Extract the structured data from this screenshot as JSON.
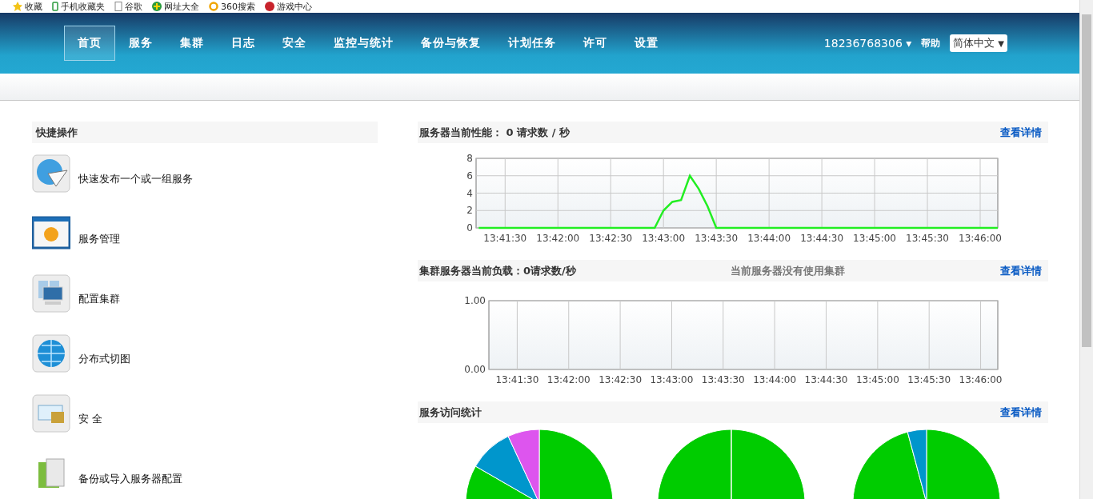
{
  "bookmarks": [
    {
      "label": "收藏",
      "kind": "star"
    },
    {
      "label": "手机收藏夹",
      "kind": "phone"
    },
    {
      "label": "谷歌",
      "kind": "page"
    },
    {
      "label": "网址大全",
      "kind": "plus"
    },
    {
      "label": "360搜索",
      "kind": "ring"
    },
    {
      "label": "游戏中心",
      "kind": "game"
    }
  ],
  "nav": [
    {
      "label": "首页",
      "selected": true
    },
    {
      "label": "服务",
      "selected": false
    },
    {
      "label": "集群",
      "selected": false
    },
    {
      "label": "日志",
      "selected": false
    },
    {
      "label": "安全",
      "selected": false
    },
    {
      "label": "监控与统计",
      "selected": false
    },
    {
      "label": "备份与恢复",
      "selected": false
    },
    {
      "label": "计划任务",
      "selected": false
    },
    {
      "label": "许可",
      "selected": false
    },
    {
      "label": "设置",
      "selected": false
    }
  ],
  "user": "18236768306",
  "user_caret": "▾",
  "help": "帮助",
  "language": "简体中文",
  "language_caret": "▼",
  "quick_actions": {
    "title": "快捷操作",
    "items": [
      {
        "label": "快速发布一个或一组服务",
        "kind": "publish"
      },
      {
        "label": "服务管理",
        "kind": "manage"
      },
      {
        "label": "配置集群",
        "kind": "cluster"
      },
      {
        "label": "分布式切图",
        "kind": "tiles"
      },
      {
        "label": "安 全",
        "kind": "security"
      },
      {
        "label": "备份或导入服务器配置",
        "kind": "backup"
      }
    ]
  },
  "performance": {
    "title": "服务器当前性能：",
    "reading": "0 请求数 / 秒",
    "link": "查看详情",
    "chart_data": {
      "type": "line",
      "grid": true,
      "ylim": [
        0,
        8
      ],
      "yticks": [
        0,
        2,
        4,
        6,
        8
      ],
      "categories": [
        null,
        null,
        null,
        "13:41:30",
        null,
        null,
        null,
        null,
        null,
        "13:42:00",
        null,
        null,
        null,
        null,
        null,
        "13:42:30",
        null,
        null,
        null,
        null,
        null,
        "13:43:00",
        null,
        null,
        null,
        null,
        null,
        "13:43:30",
        null,
        null,
        null,
        null,
        null,
        "13:44:00",
        null,
        null,
        null,
        null,
        null,
        "13:44:30",
        null,
        null,
        null,
        null,
        null,
        "13:45:00",
        null,
        null,
        null,
        null,
        null,
        "13:45:30",
        null,
        null,
        null,
        null,
        null,
        "13:46:00",
        null,
        null
      ],
      "series": [
        {
          "color": "#22ee22",
          "values": [
            0,
            0,
            0,
            0,
            0,
            0,
            0,
            0,
            0,
            0,
            0,
            0,
            0,
            0,
            0,
            0,
            0,
            0,
            0,
            0,
            0,
            2,
            3,
            3.2,
            6,
            4.5,
            2.5,
            0,
            0,
            0,
            0,
            0,
            0,
            0,
            0,
            0,
            0,
            0,
            0,
            0,
            0,
            0,
            0,
            0,
            0,
            0,
            0,
            0,
            0,
            0,
            0,
            0,
            0,
            0,
            0,
            0,
            0,
            0,
            0,
            0
          ]
        }
      ]
    }
  },
  "cluster": {
    "title": "集群服务器当前负载：0请求数/秒",
    "note": "当前服务器没有使用集群",
    "link": "查看详情",
    "chart_data": {
      "type": "line",
      "grid": true,
      "ylim": [
        0,
        1
      ],
      "yticks": [
        {
          "value": 0,
          "label": "0.00"
        },
        {
          "value": 1,
          "label": "1.00"
        }
      ],
      "categories": [
        null,
        null,
        null,
        "13:41:30",
        null,
        null,
        null,
        null,
        null,
        "13:42:00",
        null,
        null,
        null,
        null,
        null,
        "13:42:30",
        null,
        null,
        null,
        null,
        null,
        "13:43:00",
        null,
        null,
        null,
        null,
        null,
        "13:43:30",
        null,
        null,
        null,
        null,
        null,
        "13:44:00",
        null,
        null,
        null,
        null,
        null,
        "13:44:30",
        null,
        null,
        null,
        null,
        null,
        "13:45:00",
        null,
        null,
        null,
        null,
        null,
        "13:45:30",
        null,
        null,
        null,
        null,
        null,
        "13:46:00",
        null,
        null
      ]
    }
  },
  "visits": {
    "title": "服务访问统计",
    "link": "查看详情"
  }
}
